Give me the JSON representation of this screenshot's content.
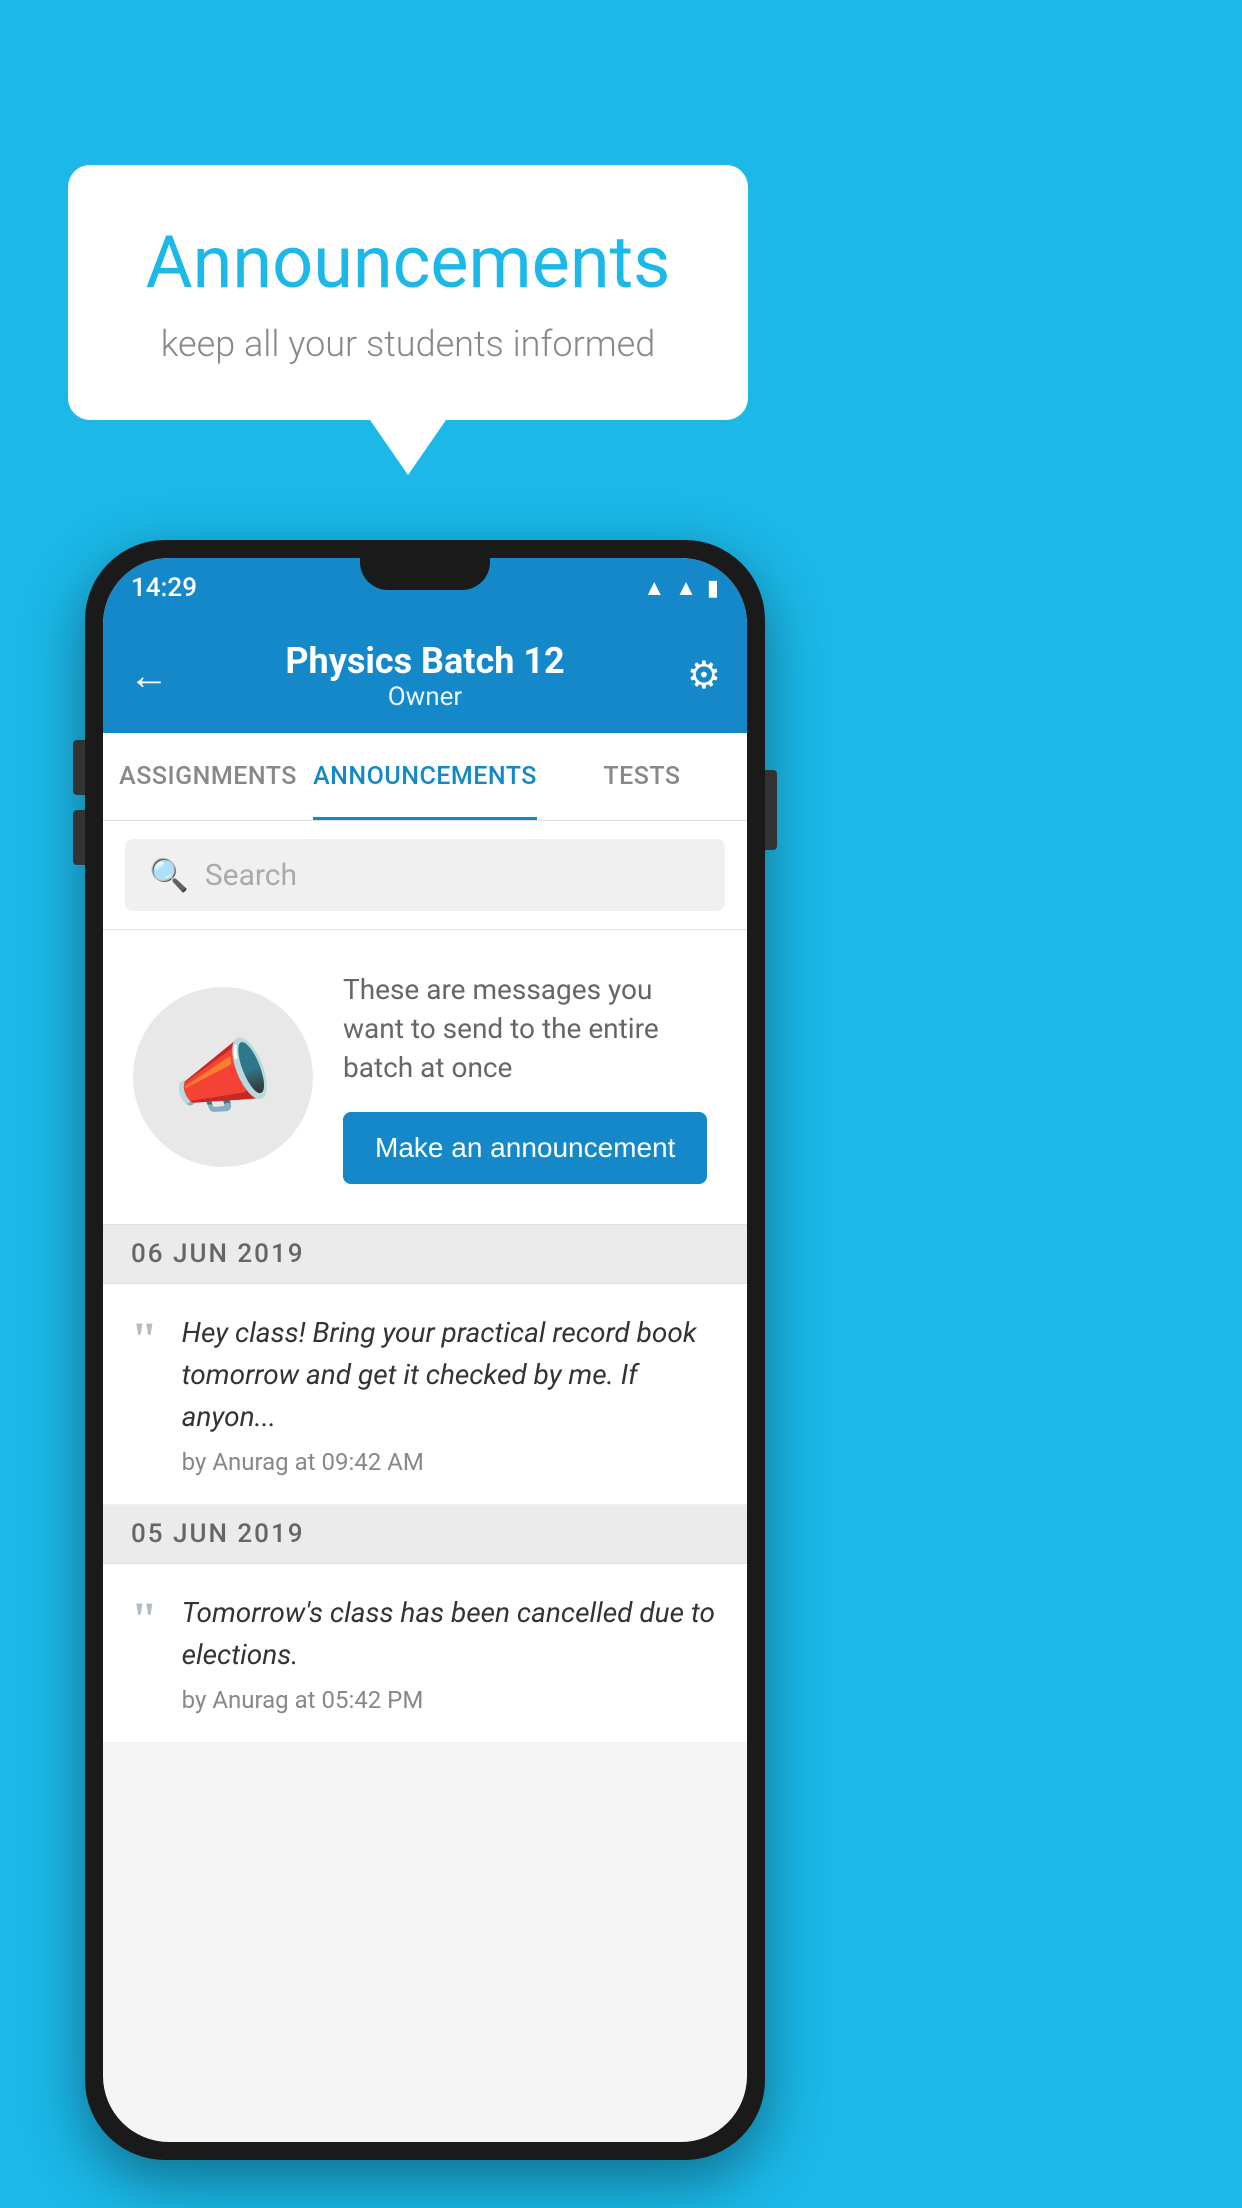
{
  "background_color": "#1BB8E8",
  "speech_bubble": {
    "title": "Announcements",
    "subtitle": "keep all your students informed"
  },
  "phone": {
    "status_bar": {
      "time": "14:29",
      "icons": [
        "wifi",
        "signal",
        "battery"
      ]
    },
    "app_bar": {
      "title": "Physics Batch 12",
      "subtitle": "Owner",
      "back_label": "←",
      "gear_label": "⚙"
    },
    "tabs": [
      {
        "label": "ASSIGNMENTS",
        "active": false
      },
      {
        "label": "ANNOUNCEMENTS",
        "active": true
      },
      {
        "label": "TESTS",
        "active": false
      },
      {
        "label": "...",
        "active": false
      }
    ],
    "search": {
      "placeholder": "Search"
    },
    "promo": {
      "text": "These are messages you want to send to the entire batch at once",
      "button_label": "Make an announcement"
    },
    "announcements": [
      {
        "date": "06  JUN  2019",
        "items": [
          {
            "text": "Hey class! Bring your practical record book tomorrow and get it checked by me. If anyon...",
            "meta": "by Anurag at 09:42 AM"
          }
        ]
      },
      {
        "date": "05  JUN  2019",
        "items": [
          {
            "text": "Tomorrow's class has been cancelled due to elections.",
            "meta": "by Anurag at 05:42 PM"
          }
        ]
      }
    ]
  }
}
